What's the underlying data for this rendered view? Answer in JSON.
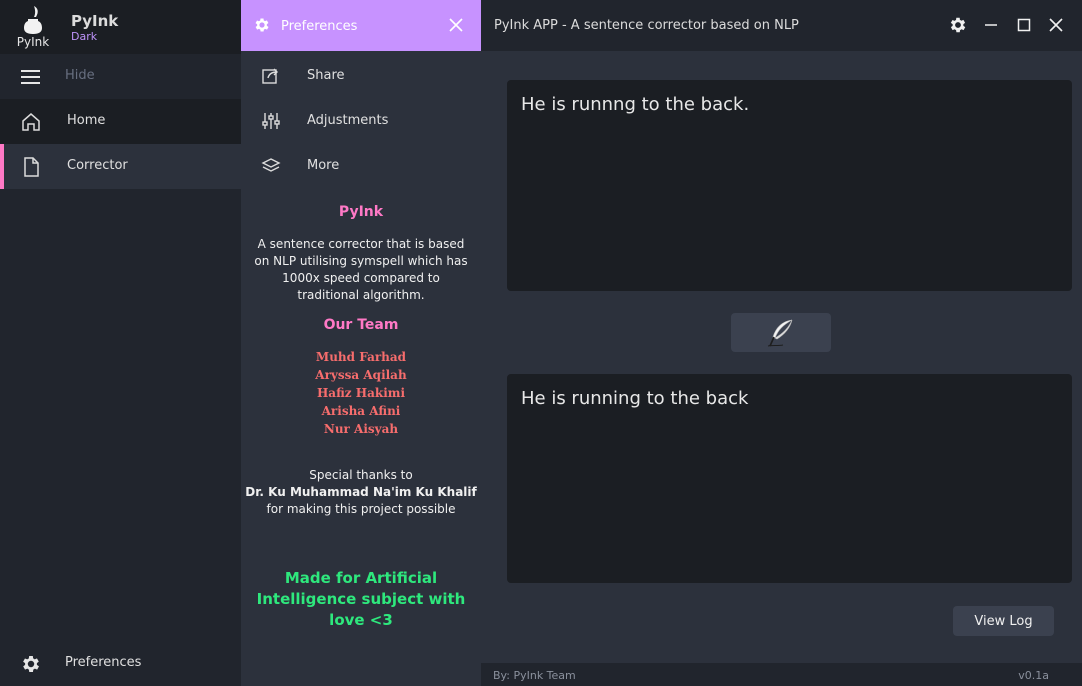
{
  "app": {
    "logo_caption": "PyInk",
    "name": "PyInk",
    "theme": "Dark"
  },
  "sidebar": {
    "hide_label": "Hide",
    "items": [
      {
        "label": "Home",
        "icon": "home-icon"
      },
      {
        "label": "Corrector",
        "icon": "file-icon",
        "active": true
      }
    ],
    "preferences_label": "Preferences"
  },
  "preferences_panel": {
    "title": "Preferences",
    "items": [
      {
        "label": "Share",
        "icon": "share-icon"
      },
      {
        "label": "Adjustments",
        "icon": "sliders-icon"
      },
      {
        "label": "More",
        "icon": "layers-icon"
      }
    ],
    "about_title": "PyInk",
    "about_text": "A sentence corrector that is based on NLP utilising symspell which has 1000x speed compared to traditional algorithm.",
    "team_title": "Our Team",
    "team": [
      "Muhd Farhad",
      "Aryssa Aqilah",
      "Hafiz Hakimi",
      "Arisha Afini",
      "Nur Aisyah"
    ],
    "thanks_prefix": "Special thanks to",
    "thanks_name": "Dr. Ku Muhammad Na'im Ku Khalif",
    "thanks_suffix": "for making this project possible",
    "made_for": "Made for Artificial Intelligence subject with love <3"
  },
  "window": {
    "title": "PyInk APP - A sentence corrector based on NLP"
  },
  "main": {
    "input_text": "He is runnng to the back.",
    "output_text": "He is running to the back",
    "correct_button_icon": "quill-icon",
    "view_log_label": "View Log"
  },
  "footer": {
    "credit": "By: PyInk Team",
    "version": "v0.1a"
  },
  "colors": {
    "accent_purple": "#c792ff",
    "active_indicator": "#ff79c6",
    "team_names": "#f76d6d",
    "made_for_green": "#2ee87d"
  }
}
